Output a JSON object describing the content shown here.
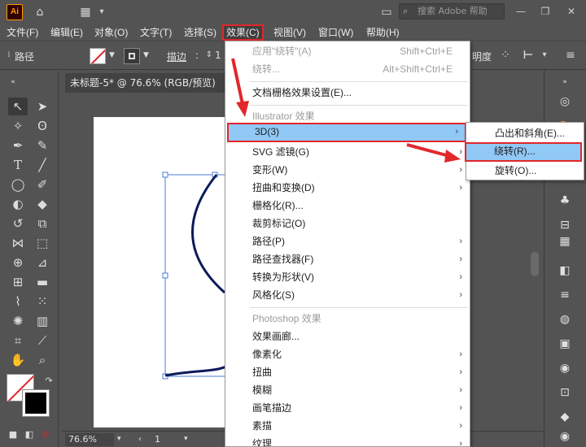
{
  "app": {
    "logo_text": "Ai",
    "search_placeholder": "搜索 Adobe 帮助"
  },
  "menubar": {
    "items": [
      {
        "label": "文件(F)"
      },
      {
        "label": "编辑(E)"
      },
      {
        "label": "对象(O)"
      },
      {
        "label": "文字(T)"
      },
      {
        "label": "选择(S)"
      },
      {
        "label": "效果(C)"
      },
      {
        "label": "视图(V)"
      },
      {
        "label": "窗口(W)"
      },
      {
        "label": "帮助(H)"
      }
    ]
  },
  "controlbar": {
    "selection_label": "路径",
    "stroke_label": "描边",
    "stroke_value": "1",
    "opacity_label": "明度"
  },
  "document": {
    "tab_title": "未标题-5* @ 76.6% (RGB/预览)",
    "zoom": "76.6%",
    "page": "1"
  },
  "effect_menu": {
    "apply_last": {
      "label": "应用\"绕转\"(A)",
      "shortcut": "Shift+Ctrl+E"
    },
    "last_effect": {
      "label": "绕转...",
      "shortcut": "Alt+Shift+Ctrl+E"
    },
    "raster_settings": {
      "label": "文档栅格效果设置(E)..."
    },
    "illustrator_section": "Illustrator 效果",
    "illustrator_items": [
      {
        "label": "3D(3)"
      },
      {
        "label": "SVG 滤镜(G)"
      },
      {
        "label": "变形(W)"
      },
      {
        "label": "扭曲和变换(D)"
      },
      {
        "label": "栅格化(R)..."
      },
      {
        "label": "裁剪标记(O)"
      },
      {
        "label": "路径(P)"
      },
      {
        "label": "路径查找器(F)"
      },
      {
        "label": "转换为形状(V)"
      },
      {
        "label": "风格化(S)"
      }
    ],
    "photoshop_section": "Photoshop 效果",
    "photoshop_items": [
      {
        "label": "效果画廊..."
      },
      {
        "label": "像素化"
      },
      {
        "label": "扭曲"
      },
      {
        "label": "模糊"
      },
      {
        "label": "画笔描边"
      },
      {
        "label": "素描"
      },
      {
        "label": "纹理"
      }
    ]
  },
  "submenu_3d": {
    "items": [
      {
        "label": "凸出和斜角(E)..."
      },
      {
        "label": "绕转(R)..."
      },
      {
        "label": "旋转(O)..."
      }
    ]
  },
  "colors": {
    "highlight": "#90c8f6",
    "annotation_red": "#e2272b",
    "ui_gray": "#535353"
  }
}
